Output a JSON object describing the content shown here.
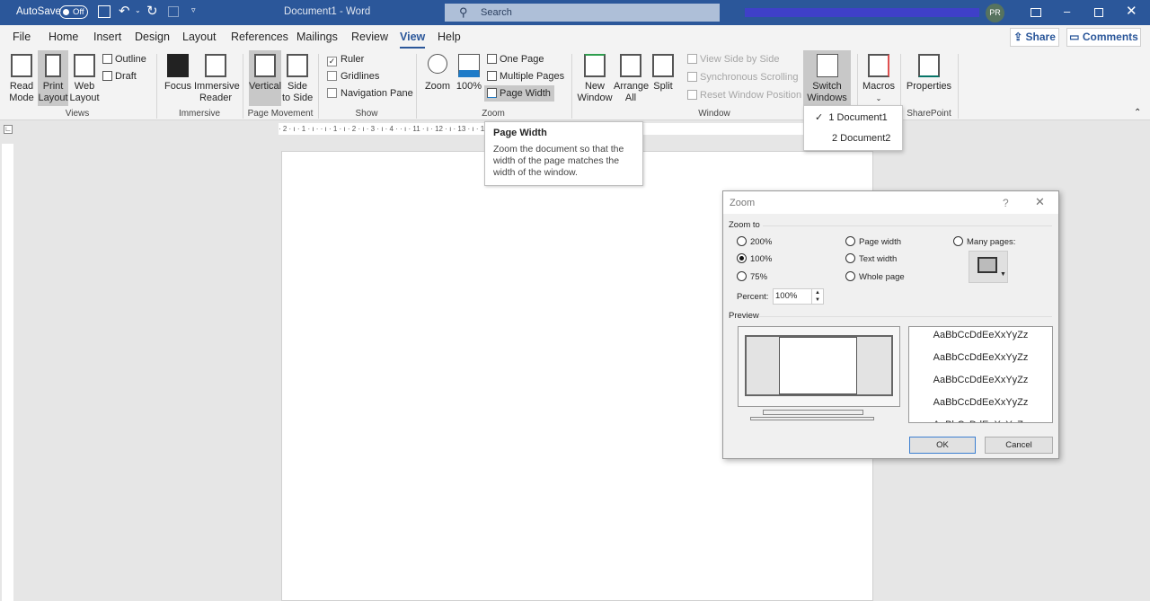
{
  "titlebar": {
    "autosave_label": "AutoSave",
    "autosave_state": "Off",
    "doc_title": "Document1  -  Word",
    "search_placeholder": "Search",
    "avatar_initials": "PR"
  },
  "tabs": [
    "File",
    "Home",
    "Insert",
    "Design",
    "Layout",
    "References",
    "Mailings",
    "Review",
    "View",
    "Help"
  ],
  "active_tab": "View",
  "share_label": "Share",
  "comments_label": "Comments",
  "ribbon": {
    "views": {
      "read_mode": "Read\nMode",
      "print_layout": "Print\nLayout",
      "web_layout": "Web\nLayout",
      "outline": "Outline",
      "draft": "Draft",
      "group": "Views"
    },
    "immersive": {
      "focus": "Focus",
      "reader": "Immersive\nReader",
      "group": "Immersive"
    },
    "page_movement": {
      "vertical": "Vertical",
      "side": "Side\nto Side",
      "group": "Page Movement"
    },
    "show": {
      "ruler": "Ruler",
      "ruler_checked": true,
      "gridlines": "Gridlines",
      "nav_pane": "Navigation Pane",
      "group": "Show"
    },
    "zoom": {
      "zoom": "Zoom",
      "hundred": "100%",
      "one_page": "One Page",
      "multiple_pages": "Multiple Pages",
      "page_width": "Page Width",
      "group": "Zoom"
    },
    "window": {
      "new_window": "New\nWindow",
      "arrange_all": "Arrange\nAll",
      "split": "Split",
      "view_side": "View Side by Side",
      "sync_scroll": "Synchronous Scrolling",
      "reset_pos": "Reset Window Position",
      "switch_windows": "Switch\nWindows",
      "group": "Window"
    },
    "macros": {
      "macros": "Macros"
    },
    "sharepoint": {
      "properties": "Properties",
      "group": "SharePoint"
    }
  },
  "ruler_labels": "· 2 · ı · 1 · ı ·  · ı · 1 · ı · 2 · ı · 3 · ı · 4 ·                                            · ı · 11 · ı · 12 · ı · 13 · ı · 14 · ı · 15 · ı ·",
  "tooltip": {
    "title": "Page Width",
    "body": "Zoom the document so that the width of the page matches the width of the window."
  },
  "switch_menu": [
    {
      "label": "1 Document1",
      "checked": true
    },
    {
      "label": "2 Document2",
      "checked": false
    }
  ],
  "dialog": {
    "title": "Zoom",
    "help": "?",
    "zoom_to": "Zoom to",
    "options": {
      "p200": "200%",
      "p100": "100%",
      "p75": "75%",
      "page_width": "Page width",
      "text_width": "Text width",
      "whole_page": "Whole page",
      "many_pages": "Many pages:"
    },
    "selected": "100%",
    "percent_label": "Percent:",
    "percent_value": "100%",
    "preview_label": "Preview",
    "sample_text": "AaBbCcDdEeXxYyZz",
    "ok": "OK",
    "cancel": "Cancel"
  }
}
